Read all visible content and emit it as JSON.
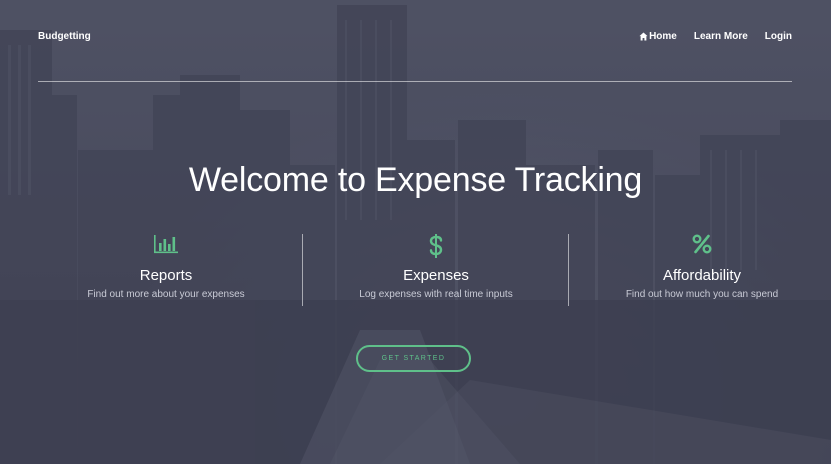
{
  "nav": {
    "brand": "Budgetting",
    "links": [
      {
        "label": "Home",
        "icon": "home-icon"
      },
      {
        "label": "Learn More"
      },
      {
        "label": "Login"
      }
    ]
  },
  "hero": {
    "title": "Welcome to Expense Tracking",
    "cta_label": "GET STARTED"
  },
  "features": [
    {
      "icon": "bar-chart-icon",
      "title": "Reports",
      "description": "Find out more about your expenses"
    },
    {
      "icon": "dollar-icon",
      "title": "Expenses",
      "description": "Log expenses with real time inputs"
    },
    {
      "icon": "percent-icon",
      "title": "Affordability",
      "description": "Find out how much you can spend"
    }
  ],
  "colors": {
    "accent": "#5fc08a",
    "overlay": "#4b4d5e"
  }
}
